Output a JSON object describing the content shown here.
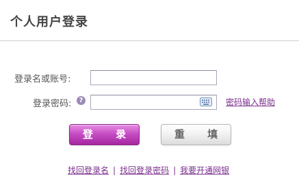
{
  "header": {
    "title": "个人用户登录"
  },
  "form": {
    "username_label": "登录名或账号:",
    "username_value": "",
    "password_label": "登录密码:",
    "password_help_icon": "?",
    "password_value": "",
    "keyboard_icon": "keyboard-icon",
    "password_help_link": "密码输入帮助"
  },
  "buttons": {
    "login": "登 录",
    "reset": "重 填"
  },
  "links": [
    "找回登录名",
    "找回登录密码",
    "我要开通网银"
  ],
  "colors": {
    "accent": "#b43cb0",
    "link": "#7a2d8c"
  }
}
